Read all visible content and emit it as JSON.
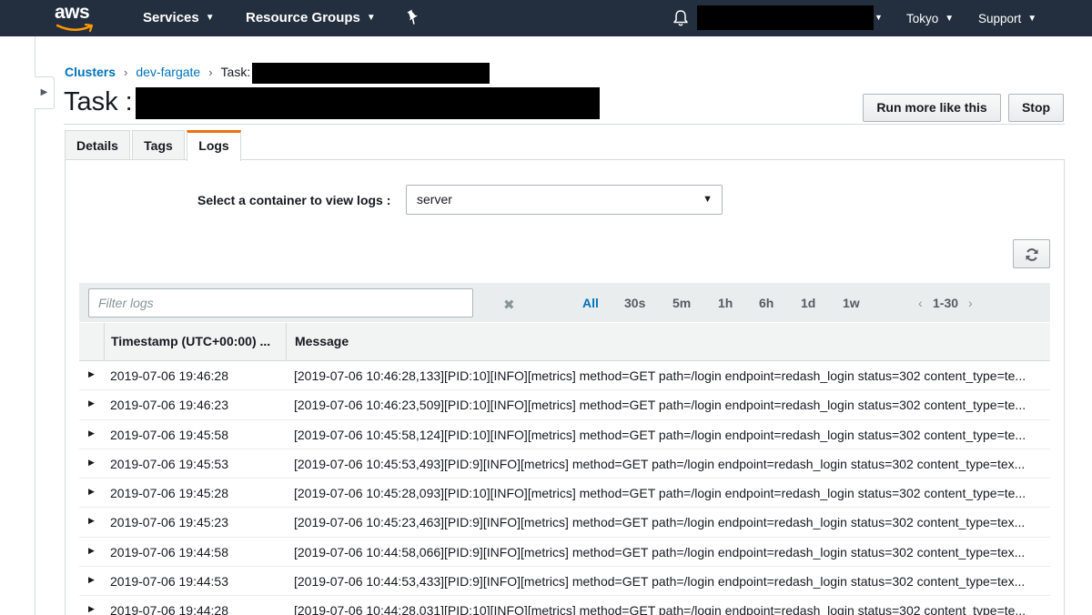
{
  "nav": {
    "logo": "aws",
    "services": "Services",
    "resource_groups": "Resource Groups",
    "region": "Tokyo",
    "support": "Support",
    "icons": [
      "pin-icon",
      "bell-icon",
      "chevron-down-icon"
    ]
  },
  "breadcrumb": {
    "clusters": "Clusters",
    "cluster": "dev-fargate",
    "task": "Task:"
  },
  "page": {
    "title": "Task :",
    "run_more": "Run more like this",
    "stop": "Stop"
  },
  "tabs": [
    {
      "label": "Details"
    },
    {
      "label": "Tags"
    },
    {
      "label": "Logs",
      "active": true
    }
  ],
  "logs": {
    "select_label": "Select a container to view logs :",
    "container": "server",
    "filter_placeholder": "Filter logs",
    "ranges": [
      "All",
      "30s",
      "5m",
      "1h",
      "6h",
      "1d",
      "1w"
    ],
    "active_range": "All",
    "pager": "1-30",
    "columns": {
      "timestamp": "Timestamp (UTC+00:00) ...",
      "message": "Message"
    },
    "rows": [
      {
        "ts": "2019-07-06 19:46:28",
        "msg": "[2019-07-06 10:46:28,133][PID:10][INFO][metrics] method=GET path=/login endpoint=redash_login status=302 content_type=te..."
      },
      {
        "ts": "2019-07-06 19:46:23",
        "msg": "[2019-07-06 10:46:23,509][PID:10][INFO][metrics] method=GET path=/login endpoint=redash_login status=302 content_type=te..."
      },
      {
        "ts": "2019-07-06 19:45:58",
        "msg": "[2019-07-06 10:45:58,124][PID:10][INFO][metrics] method=GET path=/login endpoint=redash_login status=302 content_type=te..."
      },
      {
        "ts": "2019-07-06 19:45:53",
        "msg": "[2019-07-06 10:45:53,493][PID:9][INFO][metrics] method=GET path=/login endpoint=redash_login status=302 content_type=tex..."
      },
      {
        "ts": "2019-07-06 19:45:28",
        "msg": "[2019-07-06 10:45:28,093][PID:10][INFO][metrics] method=GET path=/login endpoint=redash_login status=302 content_type=te..."
      },
      {
        "ts": "2019-07-06 19:45:23",
        "msg": "[2019-07-06 10:45:23,463][PID:9][INFO][metrics] method=GET path=/login endpoint=redash_login status=302 content_type=tex..."
      },
      {
        "ts": "2019-07-06 19:44:58",
        "msg": "[2019-07-06 10:44:58,066][PID:9][INFO][metrics] method=GET path=/login endpoint=redash_login status=302 content_type=tex..."
      },
      {
        "ts": "2019-07-06 19:44:53",
        "msg": "[2019-07-06 10:44:53,433][PID:9][INFO][metrics] method=GET path=/login endpoint=redash_login status=302 content_type=tex..."
      },
      {
        "ts": "2019-07-06 19:44:28",
        "msg": "[2019-07-06 10:44:28,031][PID:10][INFO][metrics] method=GET path=/login endpoint=redash_login status=302 content_type=te..."
      }
    ]
  },
  "colors": {
    "nav_bg": "#232f3e",
    "link": "#0073bb",
    "tab_accent": "#ec7211"
  }
}
